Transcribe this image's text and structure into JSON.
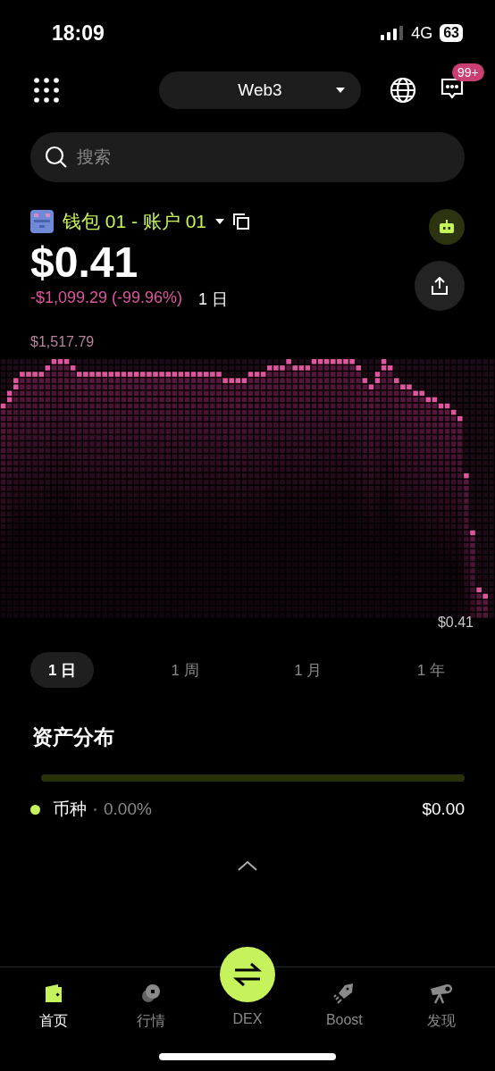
{
  "status_bar": {
    "time": "18:09",
    "network": "4G",
    "battery": "63"
  },
  "header": {
    "selector": "Web3",
    "badge": "99+"
  },
  "search": {
    "placeholder": "搜索"
  },
  "account": {
    "name": "钱包 01 - 账户 01"
  },
  "balance": {
    "value": "$0.41",
    "change": "-$1,099.29 (-99.96%)",
    "period": "1 日"
  },
  "chart": {
    "high_label": "$1,517.79",
    "low_label": "$0.41"
  },
  "periods": [
    {
      "label": "1 日",
      "selected": true
    },
    {
      "label": "1 周",
      "selected": false
    },
    {
      "label": "1 月",
      "selected": false
    },
    {
      "label": "1 年",
      "selected": false
    }
  ],
  "allocation": {
    "title": "资产分布",
    "items": [
      {
        "name": "币种",
        "share": "0.00%",
        "value": "$0.00",
        "color": "#c6f35c"
      }
    ]
  },
  "nav": [
    {
      "label": "首页",
      "kind": "wallet",
      "selected": true
    },
    {
      "label": "行情",
      "kind": "market",
      "selected": false
    },
    {
      "label": "DEX",
      "kind": "dex",
      "selected": false
    },
    {
      "label": "Boost",
      "kind": "boost",
      "selected": false
    },
    {
      "label": "发现",
      "kind": "discover",
      "selected": false
    }
  ]
}
